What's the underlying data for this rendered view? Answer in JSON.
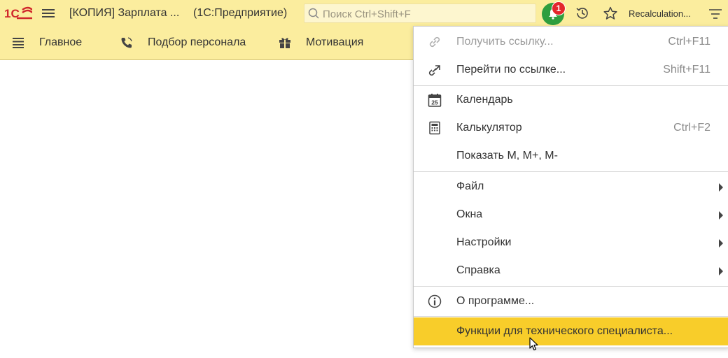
{
  "header": {
    "title": "[КОПИЯ] Зарплата ...",
    "platform": "(1С:Предприятие)",
    "search_placeholder": "Поиск Ctrl+Shift+F",
    "notifications_count": "1",
    "user": "Recalculation..."
  },
  "sections": [
    {
      "label": "Главное",
      "icon": "list-icon"
    },
    {
      "label": "Подбор персонала",
      "icon": "phone-icon"
    },
    {
      "label": "Мотивация",
      "icon": "gift-icon"
    }
  ],
  "menu": {
    "items": [
      {
        "label": "Получить ссылку...",
        "shortcut": "Ctrl+F11",
        "icon": "link-icon",
        "disabled": true
      },
      {
        "label": "Перейти по ссылке...",
        "shortcut": "Shift+F11",
        "icon": "follow-link-icon"
      },
      {
        "label": "Календарь",
        "shortcut": "",
        "icon": "calendar-icon"
      },
      {
        "label": "Калькулятор",
        "shortcut": "Ctrl+F2",
        "icon": "calculator-icon"
      },
      {
        "label": "Показать М, М+, М-",
        "shortcut": ""
      },
      {
        "label": "Файл",
        "submenu": true
      },
      {
        "label": "Окна",
        "submenu": true
      },
      {
        "label": "Настройки",
        "submenu": true
      },
      {
        "label": "Справка",
        "submenu": true
      },
      {
        "label": "О программе...",
        "icon": "info-icon"
      },
      {
        "label": "Функции для технического специалиста...",
        "highlighted": true
      }
    ],
    "calendar_day": "25"
  },
  "colors": {
    "header_bg": "#fbed9e",
    "highlight": "#f8cd2a",
    "notification_green": "#2e9e3e",
    "badge_red": "#e3262b",
    "logo_red": "#d0262b"
  }
}
